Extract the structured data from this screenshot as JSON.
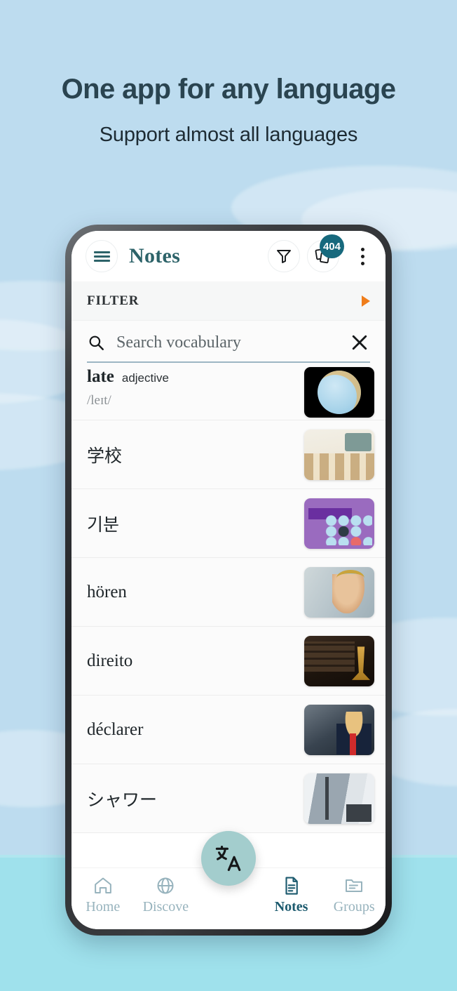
{
  "promo": {
    "headline": "One app for any language",
    "subhead": "Support almost all languages"
  },
  "colors": {
    "bg_top": "#bddcef",
    "bg_bottom": "#9fe1ec",
    "headline": "#2a4450",
    "brand_teal": "#2d6369",
    "badge_teal": "#17697d",
    "filter_arrow_orange": "#ef7d1b",
    "fab": "#a3cdcd",
    "nav_inactive": "#97b3bd",
    "nav_active": "#1c5a6e"
  },
  "appbar": {
    "menu_icon": "hamburger-icon",
    "title": "Notes",
    "filter_icon": "funnel-icon",
    "cards_icon": "cards-stack-icon",
    "cards_badge": "404",
    "overflow_icon": "kebab-menu-icon"
  },
  "filter_section": {
    "label": "FILTER",
    "expand_icon": "triangle-right-icon"
  },
  "search": {
    "icon": "search-icon",
    "value": "",
    "placeholder": "Search vocabulary",
    "clear_icon": "close-x-icon"
  },
  "vocab_list": [
    {
      "term": "late",
      "pos": "adjective",
      "phonetic": "/leɪt/",
      "thumb": "art-late",
      "thumb_alt": "cartoon-character-thumbnail"
    },
    {
      "term": "学校",
      "pos": "",
      "phonetic": "",
      "thumb": "art-school",
      "thumb_alt": "classroom-thumbnail"
    },
    {
      "term": "기분",
      "pos": "",
      "phonetic": "",
      "thumb": "art-mood",
      "thumb_alt": "korean-mood-lesson-thumbnail"
    },
    {
      "term": "hören",
      "pos": "",
      "phonetic": "",
      "thumb": "art-hoeren",
      "thumb_alt": "man-with-headphones-thumbnail"
    },
    {
      "term": "direito",
      "pos": "",
      "phonetic": "",
      "thumb": "art-direito",
      "thumb_alt": "law-books-gavel-thumbnail"
    },
    {
      "term": "déclarer",
      "pos": "",
      "phonetic": "",
      "thumb": "art-declarer",
      "thumb_alt": "politician-speech-thumbnail"
    },
    {
      "term": "シャワー",
      "pos": "",
      "phonetic": "",
      "thumb": "art-shower",
      "thumb_alt": "shower-thumbnail"
    }
  ],
  "fab": {
    "icon": "translate-icon"
  },
  "bottom_nav": {
    "items": [
      {
        "label": "Home",
        "icon": "home-icon",
        "active": false
      },
      {
        "label": "Discove",
        "icon": "globe-icon",
        "active": false
      },
      {
        "label": "Notes",
        "icon": "document-icon",
        "active": true
      },
      {
        "label": "Groups",
        "icon": "folder-icon",
        "active": false
      }
    ]
  }
}
